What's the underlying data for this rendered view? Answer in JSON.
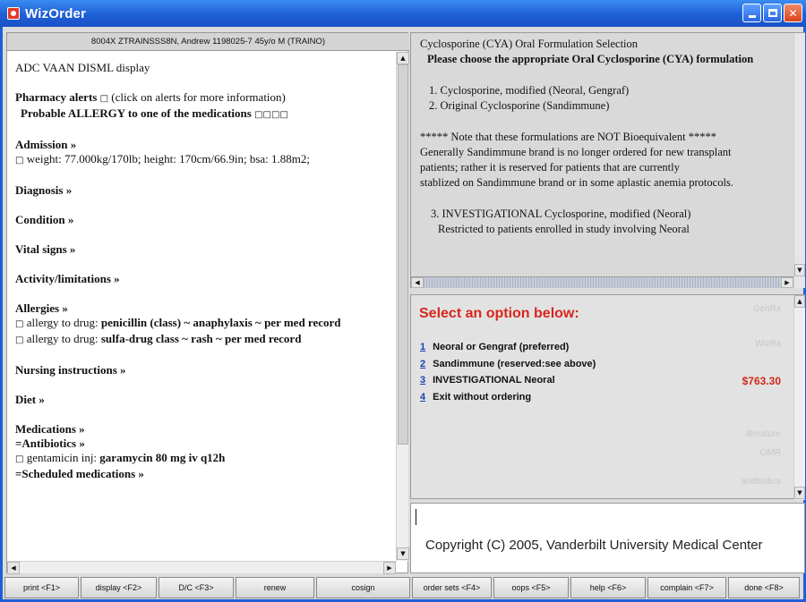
{
  "window": {
    "title": "WizOrder"
  },
  "patient": {
    "header": "8004X ZTRAINSSS8N, Andrew 1198025-7 45y/o M (TRAINO)"
  },
  "left": {
    "display_title": "ADC VAAN DISML display",
    "pharmacy_alerts": "Pharmacy alerts",
    "pharmacy_alerts_glyph": "□",
    "pharmacy_alerts_note": "(click on alerts for more information)",
    "allergy_warning": "Probable ALLERGY to one of the medications",
    "allergy_warning_glyphs": "□□□□",
    "admission_heading": "Admission »",
    "admission_line": "weight: 77.000kg/170lb;  height: 170cm/66.9in;  bsa: 1.88m2;",
    "diagnosis_heading": "Diagnosis »",
    "condition_heading": "Condition »",
    "vitals_heading": "Vital signs »",
    "activity_heading": "Activity/limitations »",
    "allergies_heading": "Allergies »",
    "allergy_1_prefix": "allergy to drug:",
    "allergy_1_body": "penicillin (class)  ~ anaphylaxis  ~  per med record",
    "allergy_2_prefix": "allergy to drug:",
    "allergy_2_body": "sulfa-drug class  ~ rash  ~  per med record",
    "nursing_heading": "Nursing instructions »",
    "diet_heading": "Diet »",
    "medications_heading": "Medications »",
    "antibiotics_heading": "=Antibiotics »",
    "gentamicin_prefix": "gentamicin inj:",
    "gentamicin_body": "garamycin  80 mg iv q12h",
    "scheduled_heading": "=Scheduled medications »"
  },
  "cya": {
    "title": "Cyclosporine (CYA) Oral Formulation Selection",
    "prompt": "Please choose the appropriate Oral Cyclosporine (CYA) formulation",
    "option_1": "1. Cyclosporine, modified (Neoral, Gengraf)",
    "option_2": "2. Original Cyclosporine (Sandimmune)",
    "note_line_1": "***** Note that these formulations are NOT Bioequivalent *****",
    "note_line_2": "Generally Sandimmune brand is no longer ordered for new transplant",
    "note_line_3": "patients; rather it is reserved for patients that are currently",
    "note_line_4": "stablized on Sandimmune brand or in some aplastic anemia protocols.",
    "option_3": "3. INVESTIGATIONAL Cyclosporine, modified (Neoral)",
    "option_3_note": "Restricted to patients enrolled in study involving Neoral"
  },
  "select": {
    "heading": "Select an option below:",
    "options": [
      {
        "num": "1",
        "label": "Neoral or Gengraf (preferred)"
      },
      {
        "num": "2",
        "label": "Sandimmune (reserved:see above)"
      },
      {
        "num": "3",
        "label": "INVESTIGATIONAL Neoral"
      },
      {
        "num": "4",
        "label": "Exit without ordering"
      }
    ],
    "price": "$763.30",
    "side_links": [
      "GenRx",
      "WizRx",
      "literature",
      "OMR",
      "antibiotics"
    ]
  },
  "footer": {
    "copyright": "Copyright (C) 2005, Vanderbilt University Medical Center"
  },
  "toolbar": {
    "buttons": [
      "print <F1>",
      "display <F2>",
      "D/C <F3>",
      "renew",
      "cosign",
      "order sets <F4>",
      "oops <F5>",
      "help <F6>",
      "complain <F7>",
      "done <F8>"
    ]
  },
  "colors": {
    "titlebar": "#1f5fd6",
    "alert_red": "#d8261c",
    "link_blue": "#1a3fb0"
  }
}
